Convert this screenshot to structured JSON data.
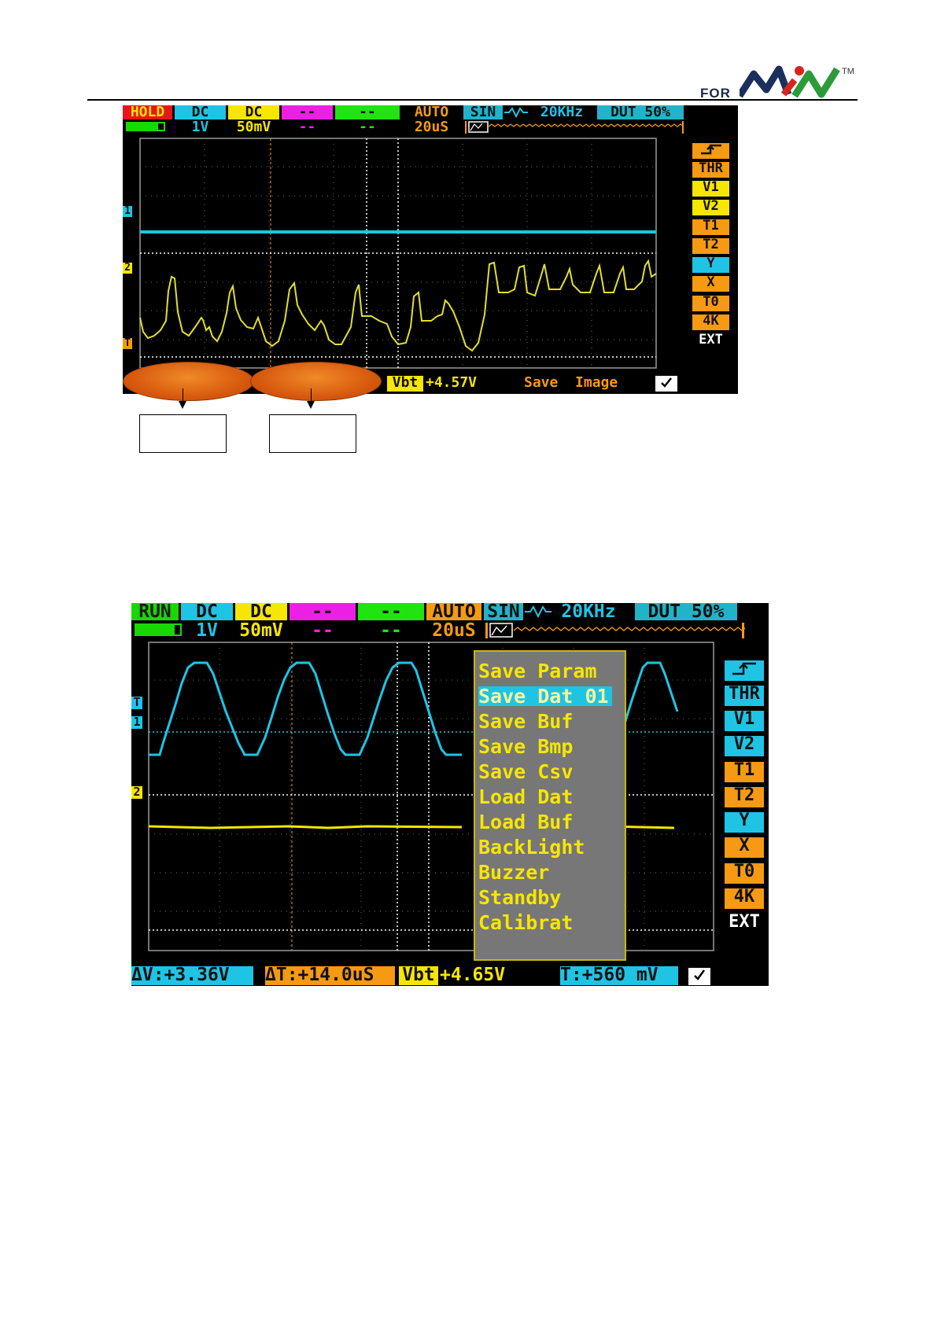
{
  "header": {
    "brand_for": "FOR",
    "brand_tm": "TM"
  },
  "scope1": {
    "top_row": [
      "HOLD",
      "DC",
      "DC",
      "--",
      "--",
      "AUTO",
      "SIN",
      "20KHz",
      "DUT 50%"
    ],
    "second_row": [
      "1V",
      "50mV",
      "--",
      "--",
      "20uS"
    ],
    "side_buttons": [
      "THR",
      "V1",
      "V2",
      "T1",
      "T2",
      "Y",
      "X",
      "T0",
      "4K",
      "EXT"
    ],
    "bottom": {
      "vbt_label": "Vbt",
      "vbt_value": "+4.57V",
      "status": "Save  Image"
    },
    "markers": {
      "ch1": "1",
      "ch2": "2",
      "trigger": "T"
    }
  },
  "scope2": {
    "top_row": [
      "RUN",
      "DC",
      "DC",
      "--",
      "--",
      "AUTO",
      "SIN",
      "20KHz",
      "DUT 50%"
    ],
    "second_row": [
      "1V",
      "50mV",
      "--",
      "--",
      "20uS"
    ],
    "side_buttons": [
      "THR",
      "V1",
      "V2",
      "T1",
      "T2",
      "Y",
      "X",
      "T0",
      "4K",
      "EXT"
    ],
    "menu": [
      "Save Param",
      "Save Dat 01",
      "Save Buf",
      "Save Bmp",
      "Save Csv",
      "Load Dat",
      "Load Buf",
      "BackLight",
      "Buzzer",
      "Standby",
      "Calibrat"
    ],
    "menu_selected": "Save Dat 01",
    "bottom": {
      "dv": "ΔV:+3.36V",
      "dt": "ΔT:+14.0uS",
      "vbt_label": "Vbt",
      "vbt_value": "+4.65V",
      "t": "T:+560 mV"
    },
    "markers": {
      "ch1": "1",
      "ch2": "2",
      "trigger": "T"
    }
  },
  "colors": {
    "ch1": "#1fc4e4",
    "ch2": "#f7e600",
    "accent_orange": "#f59a12",
    "hold": "#e8151b",
    "run": "#19d800",
    "menu_bg": "#777777"
  },
  "icons": [
    "battery-icon",
    "sine-wave-icon",
    "rising-edge-icon",
    "trigger-marker-icon",
    "check-icon",
    "logo-icon"
  ]
}
